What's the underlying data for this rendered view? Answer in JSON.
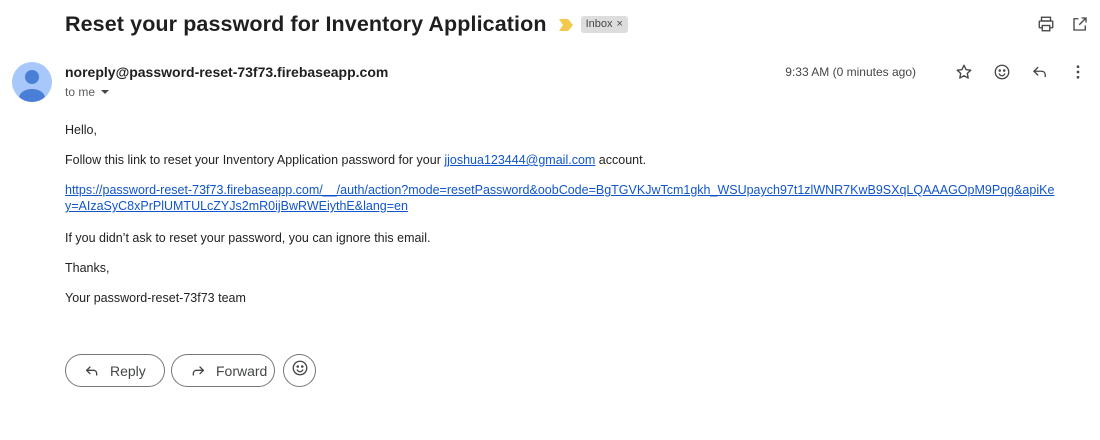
{
  "email": {
    "subject": "Reset your password for Inventory Application",
    "label": "Inbox",
    "label_close": "×",
    "important_color": "#f2c94c",
    "sender": "noreply@password-reset-73f73.firebaseapp.com",
    "recipient": "to me",
    "timestamp": "9:33 AM (0 minutes ago)"
  },
  "icons": {
    "top": [
      "print-icon",
      "open-in-new-window-icon"
    ],
    "meta": [
      "star-icon",
      "emoji-icon",
      "reply-icon",
      "more-vertical-icon"
    ]
  },
  "body": {
    "greeting": "Hello,",
    "follow_prefix": "Follow this link to reset your Inventory Application password for your ",
    "account_email": "jjoshua123444@gmail.com",
    "follow_suffix": " account.",
    "reset_link": "https://password-reset-73f73.firebaseapp.com/__/auth/action?mode=resetPassword&oobCode=BgTGVKJwTcm1gkh_WSUpaych97t1zlWNR7KwB9SXqLQAAAGOpM9Pqg&apiKey=AIzaSyC8xPrPlUMTULcZYJs2mR0ijBwRWEiythE&lang=en",
    "ignore": "If you didn’t ask to reset your password, you can ignore this email.",
    "thanks": "Thanks,",
    "signature": "Your password-reset-73f73 team"
  },
  "actions": {
    "reply_label": "Reply",
    "forward_label": "Forward"
  },
  "colors": {
    "link": "#1155cc",
    "avatar_bg": "#a8c7fa",
    "avatar_fg": "#4a7fd8",
    "chip_bg": "#dddddd"
  }
}
